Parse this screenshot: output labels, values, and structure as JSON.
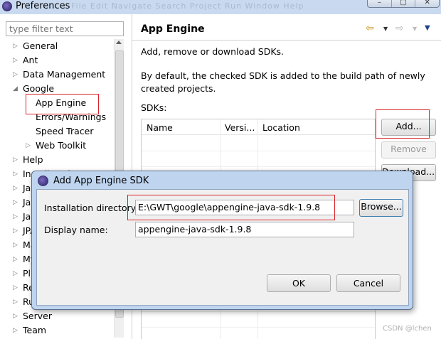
{
  "window": {
    "title": "Preferences",
    "ghost_menu": "File  Edit  Navigate  Search  Project  Run  Window  Help"
  },
  "filter": {
    "placeholder": "type filter text"
  },
  "tree": [
    {
      "label": "General",
      "expander": "collapsed"
    },
    {
      "label": "Ant",
      "expander": "collapsed"
    },
    {
      "label": "Data Management",
      "expander": "collapsed"
    },
    {
      "label": "Google",
      "expander": "expanded"
    },
    {
      "label": "App Engine",
      "expander": "none",
      "selected": true
    },
    {
      "label": "Errors/Warnings",
      "expander": "none"
    },
    {
      "label": "Speed Tracer",
      "expander": "none"
    },
    {
      "label": "Web Toolkit",
      "expander": "collapsed"
    },
    {
      "label": "Help",
      "expander": "collapsed"
    },
    {
      "label": "Install/Update",
      "expander": "collapsed"
    },
    {
      "label": "Java",
      "expander": "collapsed"
    },
    {
      "label": "Java EE",
      "expander": "collapsed"
    },
    {
      "label": "JavaScript",
      "expander": "collapsed"
    },
    {
      "label": "JPA",
      "expander": "collapsed"
    },
    {
      "label": "Maven",
      "expander": "collapsed"
    },
    {
      "label": "Mylyn",
      "expander": "collapsed"
    },
    {
      "label": "Plug-in Development",
      "expander": "collapsed"
    },
    {
      "label": "Remote Systems",
      "expander": "collapsed"
    },
    {
      "label": "Run/Debug",
      "expander": "collapsed"
    },
    {
      "label": "Server",
      "expander": "collapsed"
    },
    {
      "label": "Team",
      "expander": "collapsed"
    }
  ],
  "page": {
    "title": "App Engine",
    "description": "Add, remove or download SDKs.",
    "note_line1": "By default, the checked SDK is added to the build path of newly",
    "note_line2": "created projects.",
    "sdks_label": "SDKs:",
    "columns": [
      "Name",
      "Versi...",
      "Location"
    ],
    "buttons": {
      "add": "Add...",
      "remove": "Remove",
      "download": "Download..."
    }
  },
  "dialog": {
    "title": "Add App Engine SDK",
    "install_label": "Installation directory:",
    "install_value": "E:\\GWT\\google\\appengine-java-sdk-1.9.8",
    "display_label": "Display name:",
    "display_value": "appengine-java-sdk-1.9.8",
    "browse": "Browse...",
    "ok": "OK",
    "cancel": "Cancel"
  },
  "watermark": "CSDN @lchen",
  "colors": {
    "highlight_box": "#d8232a",
    "dialog_frame": "#bfd5ef",
    "selection": "#cce8ff"
  }
}
